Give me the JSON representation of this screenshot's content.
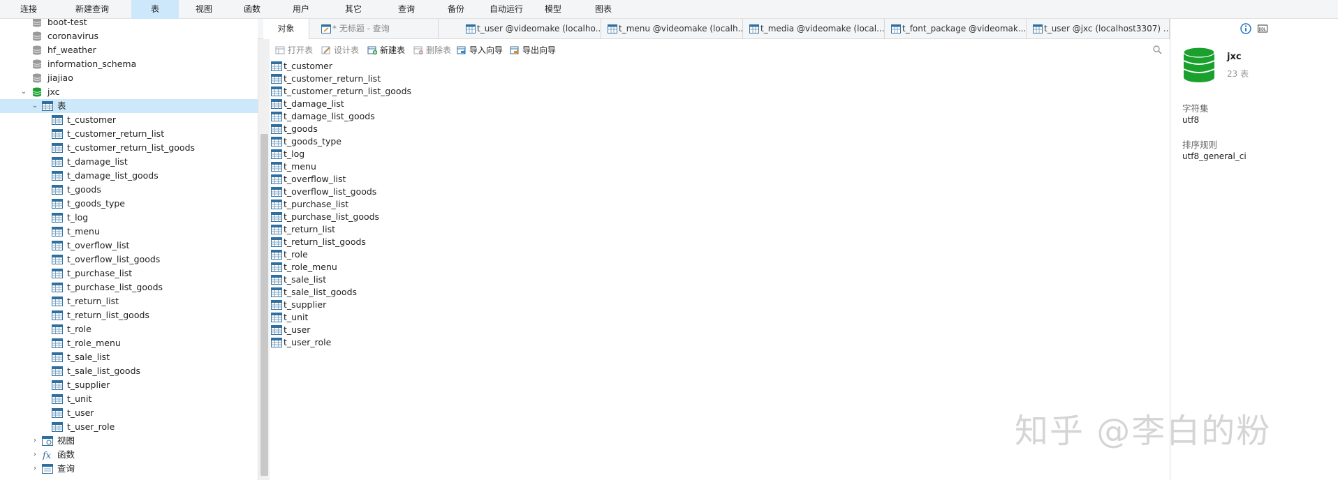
{
  "menu": [
    {
      "label": "连接",
      "active": false
    },
    {
      "label": "新建查询",
      "active": false
    },
    {
      "label": "表",
      "active": true
    },
    {
      "label": "视图",
      "active": false
    },
    {
      "label": "函数",
      "active": false
    },
    {
      "label": "用户",
      "active": false
    },
    {
      "label": "其它",
      "active": false
    },
    {
      "label": "查询",
      "active": false
    },
    {
      "label": "备份",
      "active": false
    },
    {
      "label": "自动运行",
      "active": false
    },
    {
      "label": "模型",
      "active": false
    },
    {
      "label": "图表",
      "active": false
    }
  ],
  "sidebar": {
    "databases": [
      "boot-test",
      "coronavirus",
      "hf_weather",
      "information_schema",
      "jiajiao"
    ],
    "current_db": "jxc",
    "tables_node": "表",
    "tables": [
      "t_customer",
      "t_customer_return_list",
      "t_customer_return_list_goods",
      "t_damage_list",
      "t_damage_list_goods",
      "t_goods",
      "t_goods_type",
      "t_log",
      "t_menu",
      "t_overflow_list",
      "t_overflow_list_goods",
      "t_purchase_list",
      "t_purchase_list_goods",
      "t_return_list",
      "t_return_list_goods",
      "t_role",
      "t_role_menu",
      "t_sale_list",
      "t_sale_list_goods",
      "t_supplier",
      "t_unit",
      "t_user",
      "t_user_role"
    ],
    "other_nodes": [
      "视图",
      "函数",
      "查询"
    ]
  },
  "tabs": [
    {
      "label": "对象",
      "kind": "objects"
    },
    {
      "label": "* 无标题 - 查询",
      "kind": "query"
    },
    {
      "label": "t_user @videomake (localho...",
      "kind": "table"
    },
    {
      "label": "t_menu @videomake (localh...",
      "kind": "table"
    },
    {
      "label": "t_media @videomake (local...",
      "kind": "table"
    },
    {
      "label": "t_font_package @videomak...",
      "kind": "table"
    },
    {
      "label": "t_user @jxc (localhost3307) ...",
      "kind": "table"
    }
  ],
  "toolbar": {
    "open_table": "打开表",
    "design_table": "设计表",
    "new_table": "新建表",
    "delete_table": "删除表",
    "import_wizard": "导入向导",
    "export_wizard": "导出向导"
  },
  "objects": [
    "t_customer",
    "t_customer_return_list",
    "t_customer_return_list_goods",
    "t_damage_list",
    "t_damage_list_goods",
    "t_goods",
    "t_goods_type",
    "t_log",
    "t_menu",
    "t_overflow_list",
    "t_overflow_list_goods",
    "t_purchase_list",
    "t_purchase_list_goods",
    "t_return_list",
    "t_return_list_goods",
    "t_role",
    "t_role_menu",
    "t_sale_list",
    "t_sale_list_goods",
    "t_supplier",
    "t_unit",
    "t_user",
    "t_user_role"
  ],
  "info": {
    "db_name": "jxc",
    "table_count": "23 表",
    "charset_label": "字符集",
    "charset_value": "utf8",
    "collation_label": "排序规则",
    "collation_value": "utf8_general_ci"
  },
  "watermark": "知乎 @李白的粉",
  "colors": {
    "db_icon": "#9a9a9a",
    "db_icon_active": "#1aa12d",
    "table_icon": "#2f6f9f",
    "selection": "#cde8fa"
  }
}
